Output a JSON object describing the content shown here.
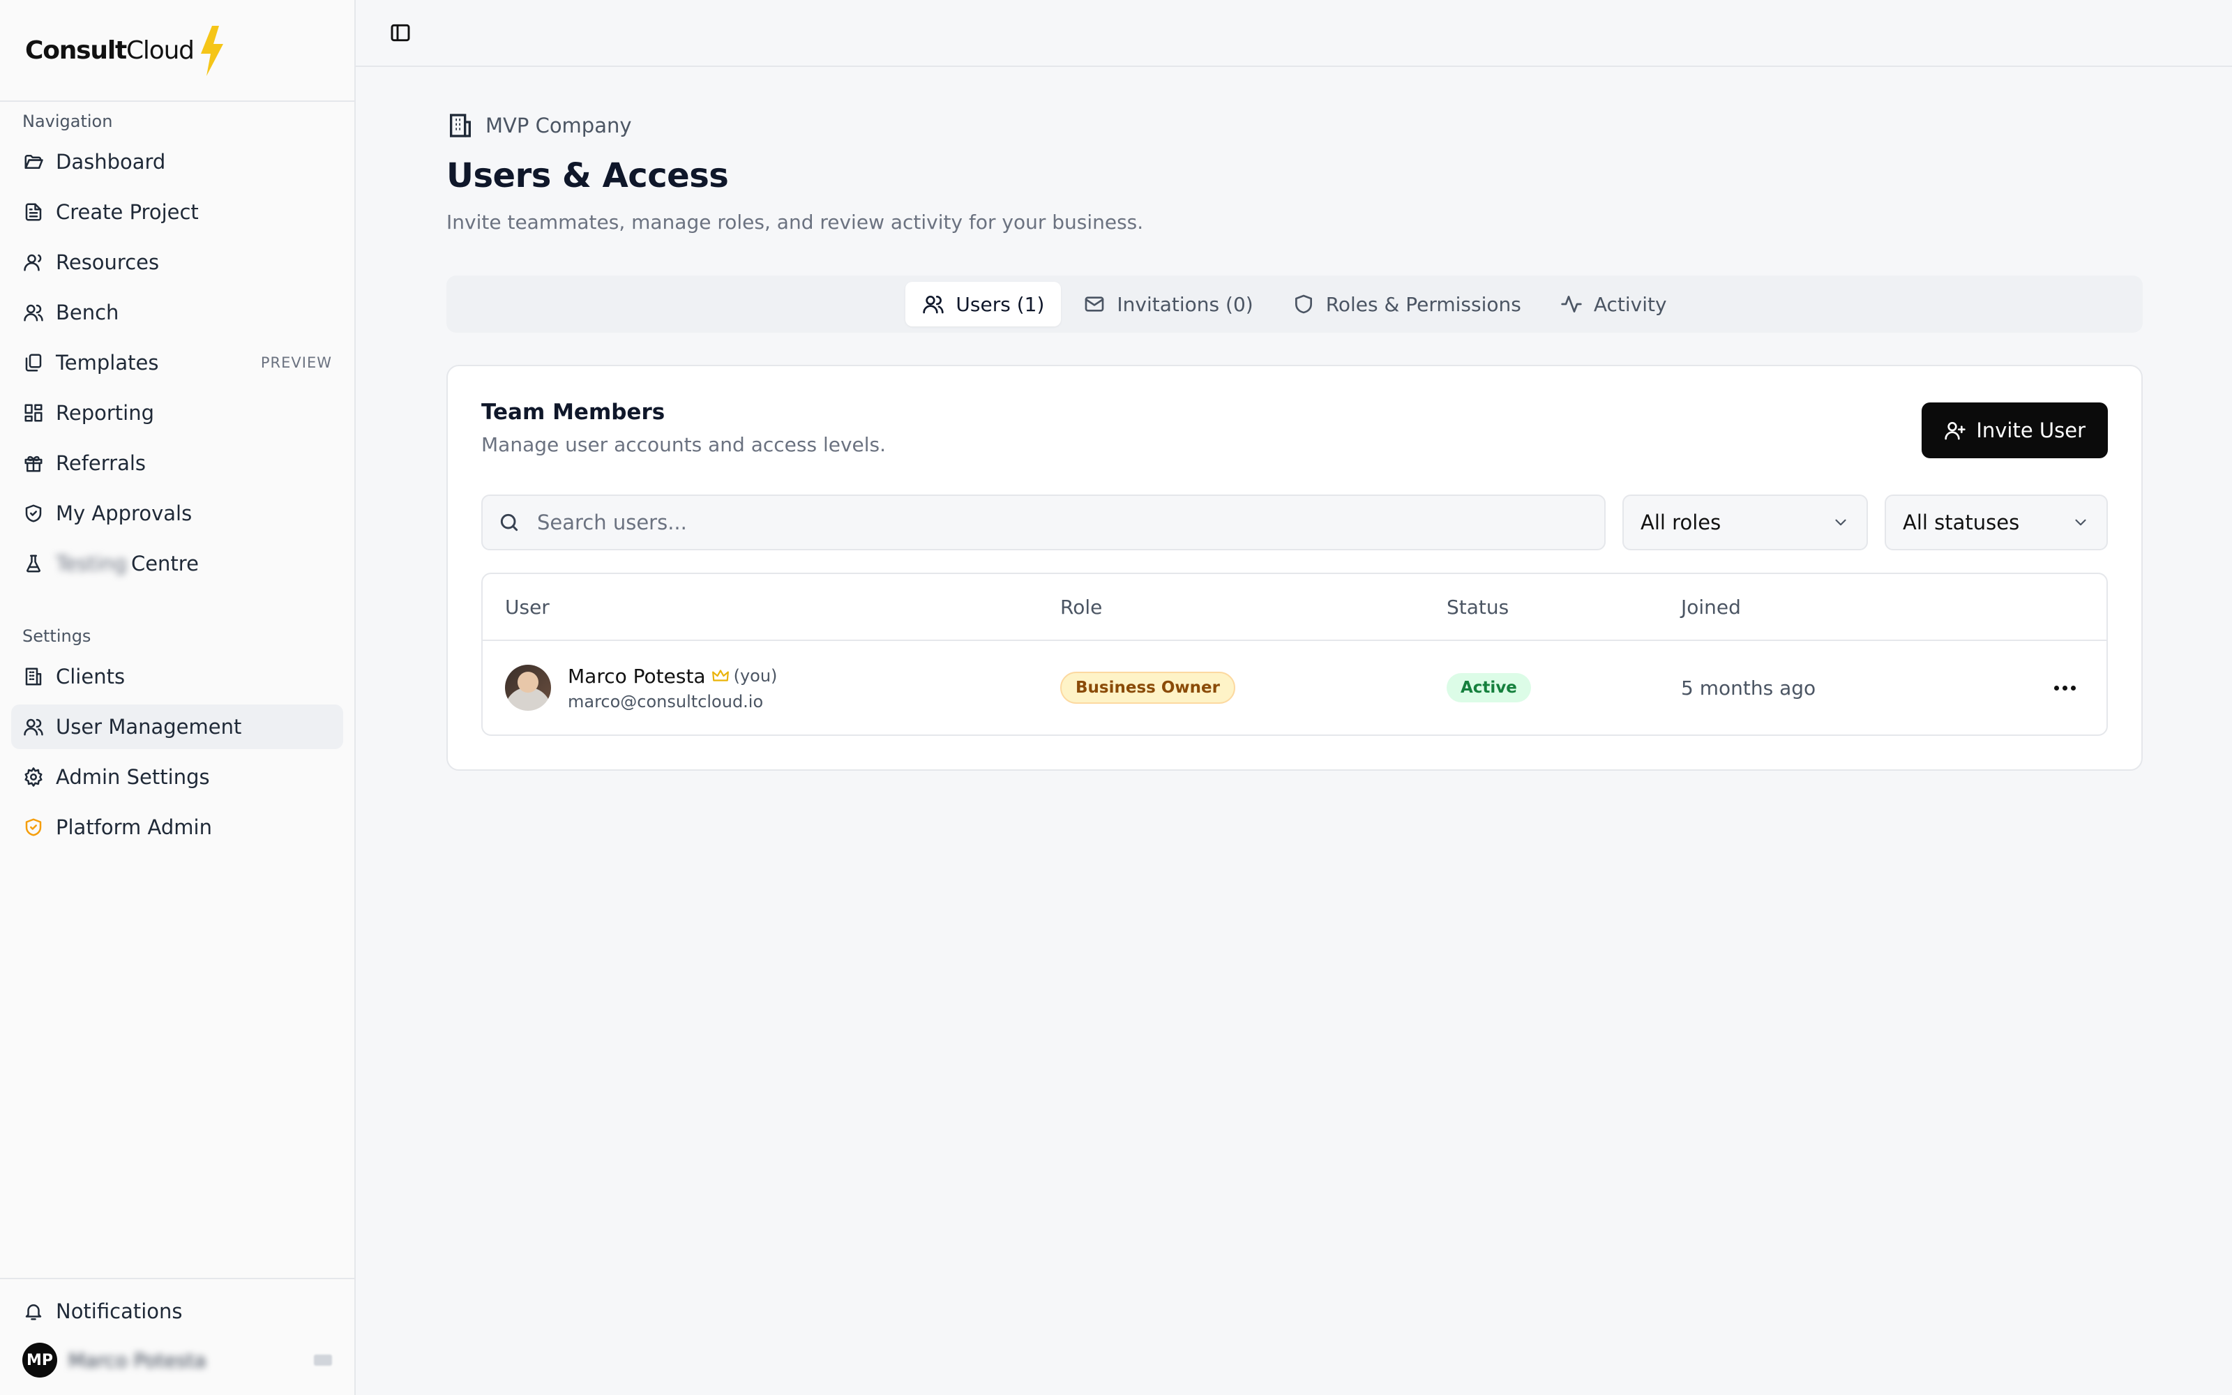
{
  "brand": {
    "name_bold": "Consult",
    "name_regular": "Cloud"
  },
  "sidebar": {
    "nav_heading": "Navigation",
    "nav_items": [
      {
        "label": "Dashboard",
        "icon": "folder-open-icon"
      },
      {
        "label": "Create Project",
        "icon": "file-text-icon"
      },
      {
        "label": "Resources",
        "icon": "user-icon"
      },
      {
        "label": "Bench",
        "icon": "users-icon"
      },
      {
        "label": "Templates",
        "icon": "copy-icon",
        "badge": "PREVIEW"
      },
      {
        "label": "Reporting",
        "icon": "layout-grid-icon"
      },
      {
        "label": "Referrals",
        "icon": "gift-icon"
      },
      {
        "label": "My Approvals",
        "icon": "shield-check-icon"
      },
      {
        "label": "Testing",
        "label_suffix": "Centre",
        "icon": "flask-icon"
      }
    ],
    "settings_heading": "Settings",
    "settings_items": [
      {
        "label": "Clients",
        "icon": "building-icon"
      },
      {
        "label": "User Management",
        "icon": "users-icon",
        "active": true
      },
      {
        "label": "Admin Settings",
        "icon": "gear-icon"
      },
      {
        "label": "Platform Admin",
        "icon": "shield-check-icon",
        "accent": "#f59e0b"
      }
    ],
    "footer": {
      "notifications_label": "Notifications",
      "user_initials": "MP",
      "user_name": "Marco Potesta"
    }
  },
  "header": {
    "company": "MVP Company",
    "title": "Users & Access",
    "description": "Invite teammates, manage roles, and review activity for your business."
  },
  "tabs": [
    {
      "label": "Users (1)",
      "icon": "users-icon",
      "active": true
    },
    {
      "label": "Invitations (0)",
      "icon": "mail-icon"
    },
    {
      "label": "Roles & Permissions",
      "icon": "shield-icon"
    },
    {
      "label": "Activity",
      "icon": "activity-icon"
    }
  ],
  "card": {
    "title": "Team Members",
    "subtitle": "Manage user accounts and access levels.",
    "invite_label": "Invite User",
    "search_placeholder": "Search users...",
    "role_filter": "All roles",
    "status_filter": "All statuses",
    "columns": [
      "User",
      "Role",
      "Status",
      "Joined"
    ],
    "rows": [
      {
        "name": "Marco Potesta",
        "you": "(you)",
        "email": "marco@consultcloud.io",
        "role": "Business Owner",
        "status": "Active",
        "joined": "5 months ago"
      }
    ]
  },
  "colors": {
    "accent_bolt": "#f5c518",
    "owner_badge_bg": "#fef3c7",
    "owner_badge_text": "#8a4b08",
    "active_badge_bg": "#dcfce7",
    "active_badge_text": "#15803d",
    "primary_button": "#0b0b0b"
  }
}
